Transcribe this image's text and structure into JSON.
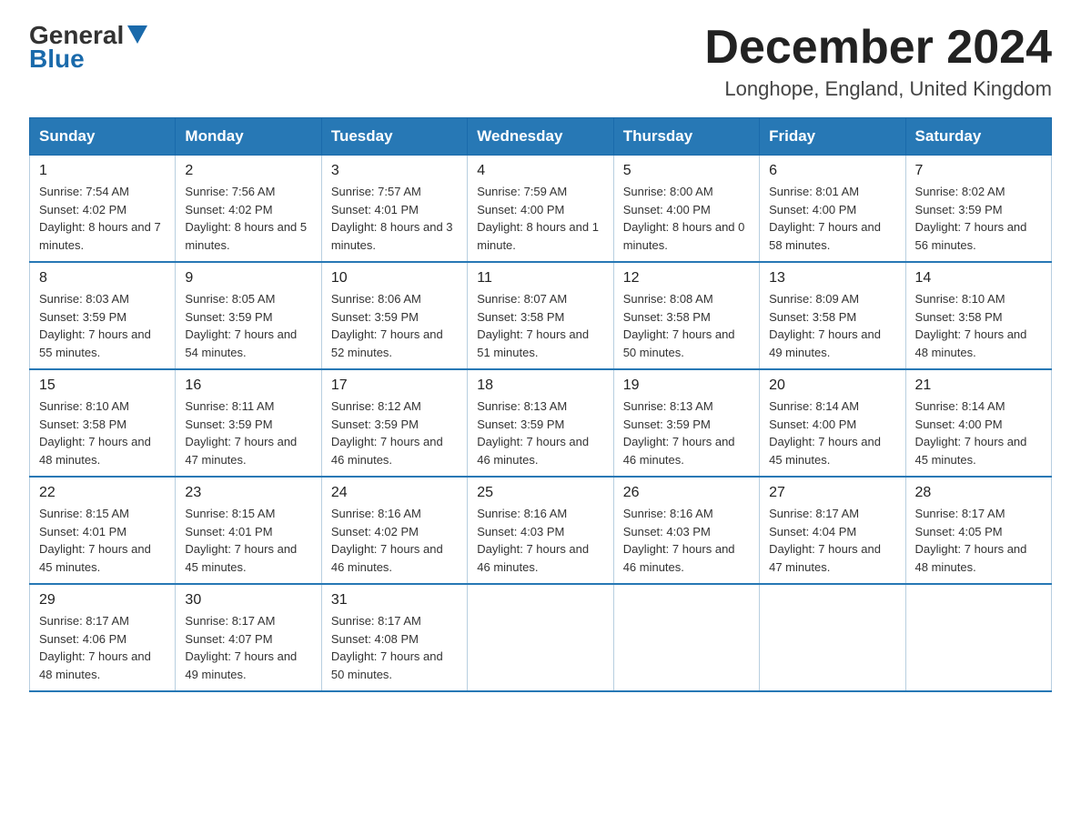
{
  "header": {
    "logo_general": "General",
    "logo_blue": "Blue",
    "month_title": "December 2024",
    "location": "Longhope, England, United Kingdom"
  },
  "weekdays": [
    "Sunday",
    "Monday",
    "Tuesday",
    "Wednesday",
    "Thursday",
    "Friday",
    "Saturday"
  ],
  "weeks": [
    [
      {
        "day": "1",
        "sunrise": "7:54 AM",
        "sunset": "4:02 PM",
        "daylight": "8 hours and 7 minutes."
      },
      {
        "day": "2",
        "sunrise": "7:56 AM",
        "sunset": "4:02 PM",
        "daylight": "8 hours and 5 minutes."
      },
      {
        "day": "3",
        "sunrise": "7:57 AM",
        "sunset": "4:01 PM",
        "daylight": "8 hours and 3 minutes."
      },
      {
        "day": "4",
        "sunrise": "7:59 AM",
        "sunset": "4:00 PM",
        "daylight": "8 hours and 1 minute."
      },
      {
        "day": "5",
        "sunrise": "8:00 AM",
        "sunset": "4:00 PM",
        "daylight": "8 hours and 0 minutes."
      },
      {
        "day": "6",
        "sunrise": "8:01 AM",
        "sunset": "4:00 PM",
        "daylight": "7 hours and 58 minutes."
      },
      {
        "day": "7",
        "sunrise": "8:02 AM",
        "sunset": "3:59 PM",
        "daylight": "7 hours and 56 minutes."
      }
    ],
    [
      {
        "day": "8",
        "sunrise": "8:03 AM",
        "sunset": "3:59 PM",
        "daylight": "7 hours and 55 minutes."
      },
      {
        "day": "9",
        "sunrise": "8:05 AM",
        "sunset": "3:59 PM",
        "daylight": "7 hours and 54 minutes."
      },
      {
        "day": "10",
        "sunrise": "8:06 AM",
        "sunset": "3:59 PM",
        "daylight": "7 hours and 52 minutes."
      },
      {
        "day": "11",
        "sunrise": "8:07 AM",
        "sunset": "3:58 PM",
        "daylight": "7 hours and 51 minutes."
      },
      {
        "day": "12",
        "sunrise": "8:08 AM",
        "sunset": "3:58 PM",
        "daylight": "7 hours and 50 minutes."
      },
      {
        "day": "13",
        "sunrise": "8:09 AM",
        "sunset": "3:58 PM",
        "daylight": "7 hours and 49 minutes."
      },
      {
        "day": "14",
        "sunrise": "8:10 AM",
        "sunset": "3:58 PM",
        "daylight": "7 hours and 48 minutes."
      }
    ],
    [
      {
        "day": "15",
        "sunrise": "8:10 AM",
        "sunset": "3:58 PM",
        "daylight": "7 hours and 48 minutes."
      },
      {
        "day": "16",
        "sunrise": "8:11 AM",
        "sunset": "3:59 PM",
        "daylight": "7 hours and 47 minutes."
      },
      {
        "day": "17",
        "sunrise": "8:12 AM",
        "sunset": "3:59 PM",
        "daylight": "7 hours and 46 minutes."
      },
      {
        "day": "18",
        "sunrise": "8:13 AM",
        "sunset": "3:59 PM",
        "daylight": "7 hours and 46 minutes."
      },
      {
        "day": "19",
        "sunrise": "8:13 AM",
        "sunset": "3:59 PM",
        "daylight": "7 hours and 46 minutes."
      },
      {
        "day": "20",
        "sunrise": "8:14 AM",
        "sunset": "4:00 PM",
        "daylight": "7 hours and 45 minutes."
      },
      {
        "day": "21",
        "sunrise": "8:14 AM",
        "sunset": "4:00 PM",
        "daylight": "7 hours and 45 minutes."
      }
    ],
    [
      {
        "day": "22",
        "sunrise": "8:15 AM",
        "sunset": "4:01 PM",
        "daylight": "7 hours and 45 minutes."
      },
      {
        "day": "23",
        "sunrise": "8:15 AM",
        "sunset": "4:01 PM",
        "daylight": "7 hours and 45 minutes."
      },
      {
        "day": "24",
        "sunrise": "8:16 AM",
        "sunset": "4:02 PM",
        "daylight": "7 hours and 46 minutes."
      },
      {
        "day": "25",
        "sunrise": "8:16 AM",
        "sunset": "4:03 PM",
        "daylight": "7 hours and 46 minutes."
      },
      {
        "day": "26",
        "sunrise": "8:16 AM",
        "sunset": "4:03 PM",
        "daylight": "7 hours and 46 minutes."
      },
      {
        "day": "27",
        "sunrise": "8:17 AM",
        "sunset": "4:04 PM",
        "daylight": "7 hours and 47 minutes."
      },
      {
        "day": "28",
        "sunrise": "8:17 AM",
        "sunset": "4:05 PM",
        "daylight": "7 hours and 48 minutes."
      }
    ],
    [
      {
        "day": "29",
        "sunrise": "8:17 AM",
        "sunset": "4:06 PM",
        "daylight": "7 hours and 48 minutes."
      },
      {
        "day": "30",
        "sunrise": "8:17 AM",
        "sunset": "4:07 PM",
        "daylight": "7 hours and 49 minutes."
      },
      {
        "day": "31",
        "sunrise": "8:17 AM",
        "sunset": "4:08 PM",
        "daylight": "7 hours and 50 minutes."
      },
      null,
      null,
      null,
      null
    ]
  ]
}
